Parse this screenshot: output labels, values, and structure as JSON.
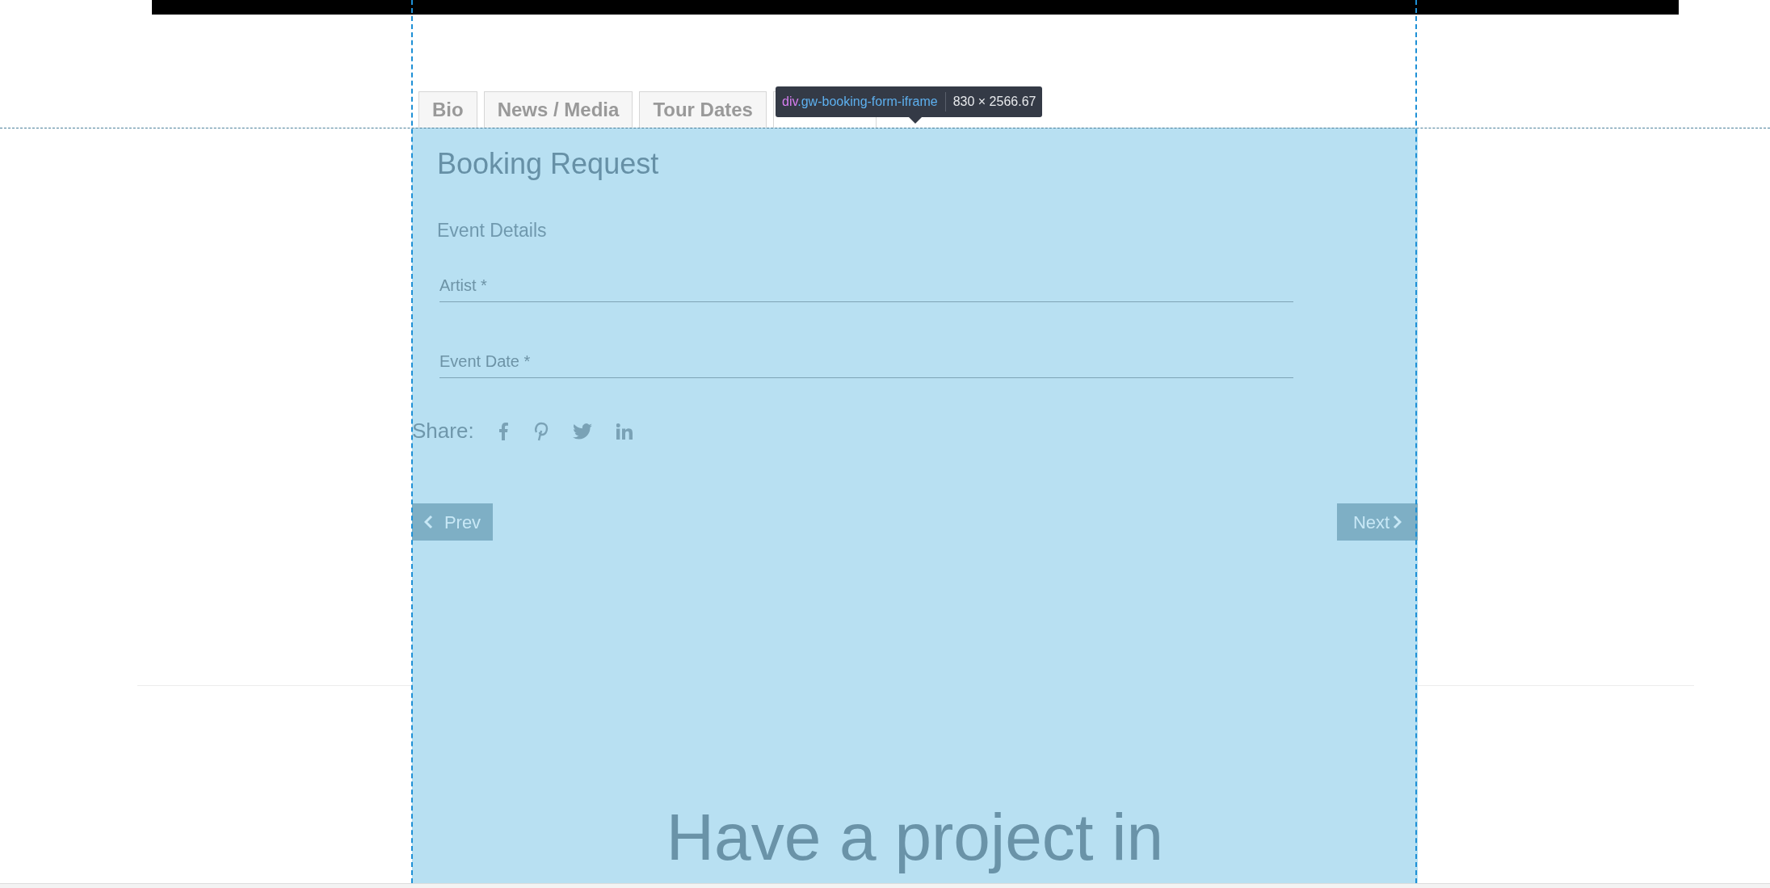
{
  "tabs": [
    {
      "label": "Bio",
      "selected": false
    },
    {
      "label": "News / Media",
      "selected": false
    },
    {
      "label": "Tour Dates",
      "selected": false
    },
    {
      "selected": true
    }
  ],
  "tooltip": {
    "tag": "div",
    "class_name": ".gw-booking-form-iframe",
    "size": "830 × 2566.67"
  },
  "form": {
    "title": "Booking Request",
    "section": "Event Details",
    "fields": [
      {
        "placeholder": "Artist *"
      },
      {
        "placeholder": "Event Date *"
      }
    ]
  },
  "share": {
    "label": "Share:"
  },
  "pager": {
    "prev": "Prev",
    "next": "Next"
  },
  "footer_heading": "Have a project in"
}
